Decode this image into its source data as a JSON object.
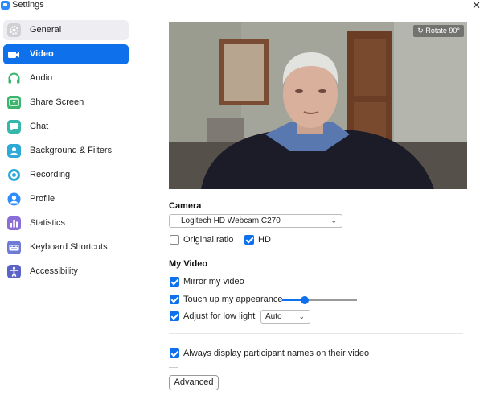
{
  "window": {
    "title": "Settings"
  },
  "sidebar": {
    "items": [
      {
        "label": "General",
        "icon": "gear-icon",
        "color": "#d0d0d0"
      },
      {
        "label": "Video",
        "icon": "video-camera-icon",
        "color": "#ffffff"
      },
      {
        "label": "Audio",
        "icon": "headphones-icon",
        "color": "#3bb56b"
      },
      {
        "label": "Share Screen",
        "icon": "share-screen-icon",
        "color": "#3bb56b"
      },
      {
        "label": "Chat",
        "icon": "chat-icon",
        "color": "#35b7ab"
      },
      {
        "label": "Background & Filters",
        "icon": "background-icon",
        "color": "#2fa9d8"
      },
      {
        "label": "Recording",
        "icon": "recording-icon",
        "color": "#2fa9d8"
      },
      {
        "label": "Profile",
        "icon": "profile-icon",
        "color": "#2d8cff"
      },
      {
        "label": "Statistics",
        "icon": "statistics-icon",
        "color": "#8a6dd6"
      },
      {
        "label": "Keyboard Shortcuts",
        "icon": "keyboard-icon",
        "color": "#6d7bd6"
      },
      {
        "label": "Accessibility",
        "icon": "accessibility-icon",
        "color": "#5b63c9"
      }
    ],
    "active": "Video"
  },
  "preview": {
    "rotate_label": "Rotate 90°"
  },
  "camera": {
    "heading": "Camera",
    "selected": "Logitech HD Webcam C270",
    "original_ratio_label": "Original ratio",
    "original_ratio_checked": false,
    "hd_label": "HD",
    "hd_checked": true
  },
  "my_video": {
    "heading": "My Video",
    "mirror_label": "Mirror my video",
    "mirror_checked": true,
    "touch_up_label": "Touch up my appearance",
    "touch_up_checked": true,
    "touch_up_level": 0.3,
    "low_light_label": "Adjust for low light",
    "low_light_checked": true,
    "low_light_mode": "Auto"
  },
  "participants": {
    "always_display_names_label": "Always display participant names on their video",
    "always_display_names_checked": true
  },
  "advanced_label": "Advanced",
  "colors": {
    "accent": "#0e71eb"
  }
}
